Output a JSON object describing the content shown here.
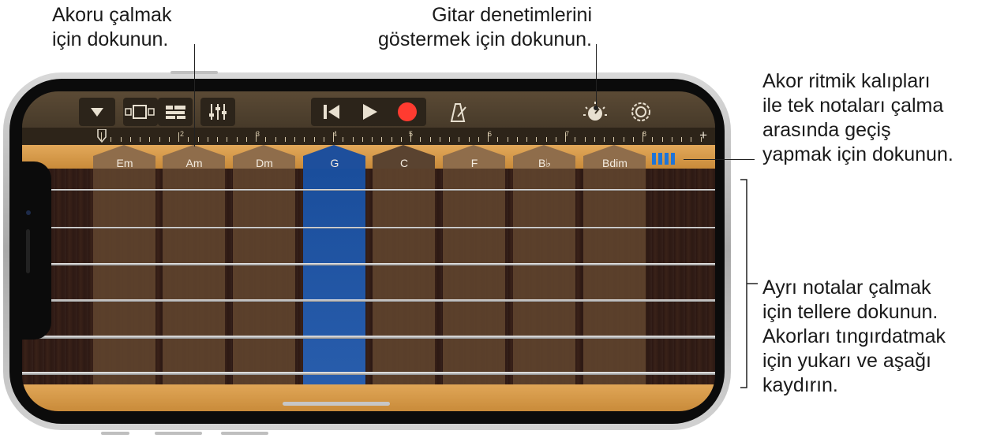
{
  "callouts": {
    "chord_tap": [
      "Akoru çalmak",
      "için dokunun."
    ],
    "guitar_controls": [
      "Gitar denetimlerini",
      "göstermek için dokunun."
    ],
    "toggle_mode": [
      "Akor ritmik kalıpları",
      "ile tek notaları çalma",
      "arasında geçiş",
      "yapmak için dokunun."
    ],
    "strings": [
      "Ayrı notalar çalmak",
      "için tellere dokunun.",
      "Akorları tıngırdatmak",
      "için yukarı ve aşağı",
      "kaydırın."
    ]
  },
  "ruler": {
    "numbers": [
      "2",
      "3",
      "4",
      "5",
      "6",
      "7",
      "8"
    ],
    "add_label": "+"
  },
  "chords": [
    "Em",
    "Am",
    "Dm",
    "G",
    "C",
    "F",
    "B♭",
    "Bdim"
  ],
  "selected_chord": "G",
  "colors": {
    "accent_blue": "#1e74d8",
    "record_red": "#ff3b30",
    "wood": "#d49a4a"
  },
  "icons": [
    "dropdown-icon",
    "view-toggle-icon",
    "tracks-icon",
    "mixer-icon",
    "rewind-icon",
    "play-icon",
    "record-icon",
    "metronome-icon",
    "guitar-controls-icon",
    "settings-icon",
    "notes-toggle-icon"
  ]
}
